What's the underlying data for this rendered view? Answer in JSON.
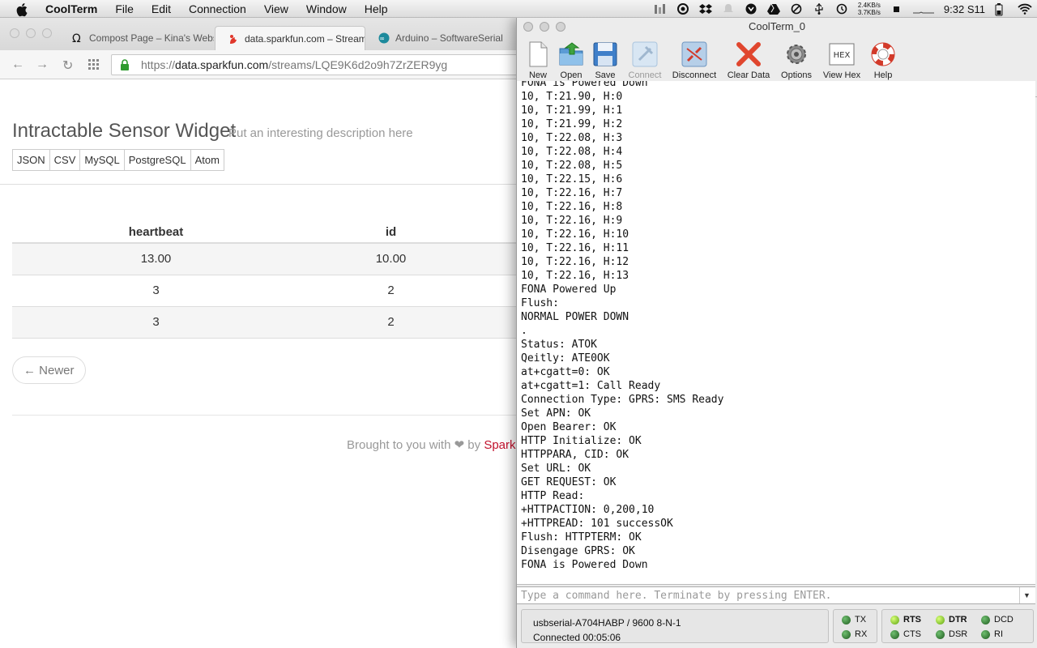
{
  "menubar": {
    "app": "CoolTerm",
    "items": [
      "File",
      "Edit",
      "Connection",
      "View",
      "Window",
      "Help"
    ],
    "net_up": "2.4KB/s",
    "net_down": "3.7KB/s",
    "clock": "9:32 S11"
  },
  "browser": {
    "tabs": [
      {
        "label": "Compost Page – Kina's Webs"
      },
      {
        "label": "data.sparkfun.com – Stream"
      },
      {
        "label": "Arduino – SoftwareSerial"
      }
    ],
    "url_prefix": "https://",
    "url_domain": "data.sparkfun.com",
    "url_path": "/streams/LQE9K6d2o9h7ZrZER9yg"
  },
  "page": {
    "title": "Intractable Sensor Widget",
    "description": "Put an interesting description here",
    "formats": [
      "JSON",
      "CSV",
      "MySQL",
      "PostgreSQL",
      "Atom"
    ],
    "table": {
      "headers": [
        "heartbeat",
        "id"
      ],
      "rows": [
        [
          "13.00",
          "10.00"
        ],
        [
          "3",
          "2"
        ],
        [
          "3",
          "2"
        ]
      ]
    },
    "newer_label": "← Newer",
    "footer_prefix": "Brought to you with ❤ by",
    "footer_brand": "Spark"
  },
  "coolterm": {
    "title": "CoolTerm_0",
    "toolbar": [
      "New",
      "Open",
      "Save",
      "Connect",
      "Disconnect",
      "Clear Data",
      "Options",
      "View Hex",
      "Help"
    ],
    "hex_icon_text": "HEX",
    "lines": [
      "FONA is Powered Down",
      "10, T:21.90, H:0",
      "10, T:21.99, H:1",
      "10, T:21.99, H:2",
      "10, T:22.08, H:3",
      "10, T:22.08, H:4",
      "10, T:22.08, H:5",
      "10, T:22.15, H:6",
      "10, T:22.16, H:7",
      "10, T:22.16, H:8",
      "10, T:22.16, H:9",
      "10, T:22.16, H:10",
      "10, T:22.16, H:11",
      "10, T:22.16, H:12",
      "10, T:22.16, H:13",
      "FONA Powered Up",
      "Flush:",
      "NORMAL POWER DOWN",
      ".",
      "Status: ATOK",
      "Qeitly: ATE0OK",
      "at+cgatt=0: OK",
      "at+cgatt=1: Call Ready",
      "Connection Type: GPRS: SMS Ready",
      "Set APN: OK",
      "Open Bearer: OK",
      "HTTP Initialize: OK",
      "HTTPPARA, CID: OK",
      "Set URL: OK",
      "GET REQUEST: OK",
      "HTTP Read:",
      "+HTTPACTION: 0,200,10",
      "+HTTPREAD: 101 successOK",
      "Flush: HTTPTERM: OK",
      "Disengage GPRS: OK",
      "FONA is Powered Down"
    ],
    "command_placeholder": "Type a command here. Terminate by pressing ENTER.",
    "port": "usbserial-A704HABP / 9600 8-N-1",
    "connected": "Connected 00:05:06",
    "leds": {
      "tx": "TX",
      "rx": "RX",
      "rts": "RTS",
      "cts": "CTS",
      "dtr": "DTR",
      "dsr": "DSR",
      "dcd": "DCD",
      "ri": "RI"
    }
  }
}
